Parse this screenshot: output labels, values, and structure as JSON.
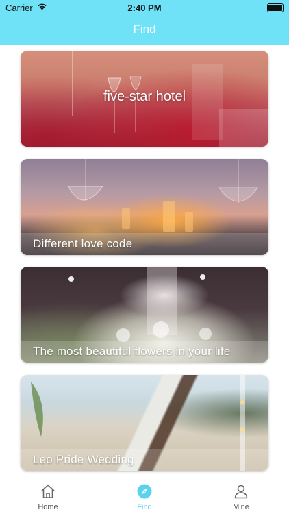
{
  "status_bar": {
    "carrier": "Carrier",
    "time": "2:40 PM"
  },
  "nav": {
    "title": "Find"
  },
  "cards": [
    {
      "caption": "five-star hotel",
      "caption_style": "center"
    },
    {
      "caption": "Different love code",
      "caption_style": "bottom"
    },
    {
      "caption": "The most beautiful flowers in your life",
      "caption_style": "bottom"
    },
    {
      "caption": "Leo Pride Wedding",
      "caption_style": "bottom"
    }
  ],
  "tabs": [
    {
      "label": "Home",
      "icon": "home-icon",
      "active": false
    },
    {
      "label": "Find",
      "icon": "compass-icon",
      "active": true
    },
    {
      "label": "Mine",
      "icon": "person-icon",
      "active": false
    }
  ],
  "colors": {
    "header": "#6fe2f7",
    "accent": "#5ad2ee",
    "tab_inactive": "#555555"
  }
}
